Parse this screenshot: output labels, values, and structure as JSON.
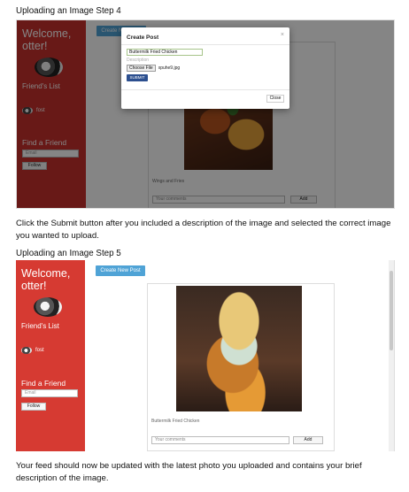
{
  "step4": {
    "heading": "Uploading an Image Step 4",
    "app": {
      "welcome": "Welcome, otter!",
      "friends_title": "Friend's List",
      "friend_name": "fost",
      "find_title": "Find a Friend",
      "email_placeholder": "Email",
      "follow_label": "Follow",
      "create_button": "Create New Post",
      "caption": "Wings and Fries",
      "comment_placeholder": "Your comments",
      "add_label": "Add"
    },
    "modal": {
      "title": "Create Post",
      "close_x": "×",
      "title_value": "Buttermilk Fried Chicken",
      "description_label": "Description",
      "choose_file_label": "Choose File",
      "file_name": "xpuhe9.jpg",
      "submit_label": "SUBMIT",
      "close_label": "Close"
    }
  },
  "instruction4": "Click the Submit button after you included a description of the image and selected the correct image you wanted to upload.",
  "step5": {
    "heading": "Uploading an Image Step 5",
    "app": {
      "welcome": "Welcome, otter!",
      "friends_title": "Friend's List",
      "friend_name": "fost",
      "find_title": "Find a Friend",
      "email_placeholder": "Email",
      "follow_label": "Follow",
      "create_button": "Create New Post",
      "caption": "Buttermilk Fried Chicken",
      "comment_placeholder": "Your comments",
      "add_label": "Add"
    }
  },
  "instruction5": "Your feed should now be updated with the latest photo you uploaded and contains your brief description of the image."
}
